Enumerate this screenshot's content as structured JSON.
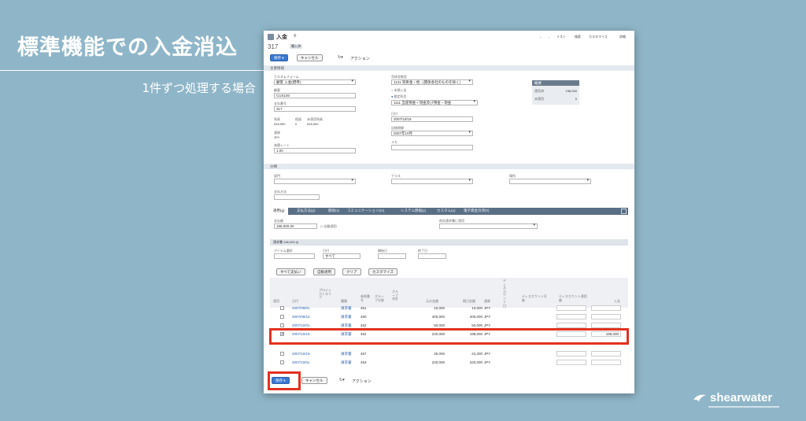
{
  "slide": {
    "headline": "標準機能での入金消込",
    "subline": "1件ずつ処理する場合",
    "brand": "shearwater"
  },
  "window": {
    "title": "入金",
    "record_number": "317",
    "record_status": "購入済",
    "nav": {
      "list": "リスト",
      "search": "検索",
      "customize": "カスタマイズ",
      "more": "詳細"
    }
  },
  "toolbar": {
    "save": "保存",
    "cancel": "キャンセル",
    "actions": "アクション"
  },
  "sections": {
    "main": "主要情報",
    "classification": "分類"
  },
  "form": {
    "custom_form_label": "カスタムフォーム",
    "custom_form_value": "顧客 入金(標準)",
    "customer_label": "顧客",
    "customer_value": "CUS100",
    "payment_no_label": "支払番号",
    "payment_no_value": "317",
    "balance_label": "残高",
    "balance_value": "516,900",
    "pending_label": "保留",
    "pending_value": "0",
    "unapplied_label": "未適用残高",
    "unapplied_value": "516,900",
    "currency_label": "通貨",
    "currency_value": "JPY",
    "rate_label": "為替レート",
    "rate_value": "1.00",
    "ar_account_label": "売掛金勘定",
    "ar_account_value": "1131 売掛金・他...(関係会社のものを除く)",
    "undeposited_label": "未預入金",
    "deposit_label": "勘定科目",
    "deposit_account_value": "1111 当座預金・現金及び預金・現金",
    "date_label": "日付",
    "date_value": "2007/10/19",
    "period_label": "記帳期間",
    "period_value": "2007年10月",
    "memo_label": "メモ",
    "dept_label": "部門",
    "class_label": "クラス",
    "location_label": "場所",
    "payment_method_label": "支払方法"
  },
  "summary": {
    "title": "概要",
    "applied_label": "適用済",
    "applied_value": "198,000",
    "unapplied_label": "未適用",
    "unapplied_value": "0"
  },
  "tabs": [
    "適用(g)",
    "支払方法(p)",
    "関係(s)",
    "コミュニケーション(m)",
    "システム情報(y)",
    "カスタム(u)",
    "電子資金決済(h)"
  ],
  "apply": {
    "payment_label": "支払額",
    "payment_value": "198,000.00",
    "auto_apply_label": "自動適用",
    "reconcile_label": "前払請求書に適用",
    "invoice_group": "請求書 198,000 (i)",
    "filter_item_label": "アイテム選択",
    "filter_date_label": "日付",
    "filter_date_value": "すべて",
    "filter_start_label": "開始日",
    "filter_end_label": "終了日",
    "btn_pay_all": "すべて支払い",
    "btn_auto": "自動適用",
    "btn_clear": "クリア",
    "btn_custom": "カスタマイズ"
  },
  "columns": [
    "適用",
    "日付",
    "プロジェクトタイプ",
    "種類",
    "参照番号",
    "グループ分割",
    "グループ合計",
    "元の金額",
    "期日金額",
    "通貨",
    "ディスカウント日",
    "ディスカウント可能",
    "ディスカウント適用額",
    "入金"
  ],
  "rows": [
    {
      "checked": false,
      "date": "2007/09/01",
      "type": "請求書",
      "ref": "451",
      "orig": "10,000",
      "due": "10,000",
      "cur": "JPY",
      "pay": ""
    },
    {
      "checked": false,
      "date": "2007/09/10",
      "type": "請求書",
      "ref": "450",
      "orig": "400,000",
      "due": "200,000",
      "cur": "JPY",
      "pay": ""
    },
    {
      "checked": false,
      "date": "2007/10/01",
      "type": "請求書",
      "ref": "462",
      "orig": "50,000",
      "due": "50,000",
      "cur": "JPY",
      "pay": ""
    },
    {
      "checked": true,
      "date": "2007/10/19",
      "type": "請求書",
      "ref": "452",
      "orig": "220,000",
      "due": "198,000",
      "cur": "JPY",
      "pay": "198,000"
    },
    {
      "checked": false,
      "date": "2007/10/19",
      "type": "請求書",
      "ref": "457",
      "orig": "25,000",
      "due": "24,200",
      "cur": "JPY",
      "pay": ""
    },
    {
      "checked": false,
      "date": "2007/10/01",
      "type": "請求書",
      "ref": "453",
      "orig": "220,000",
      "due": "220,000",
      "cur": "JPY",
      "pay": ""
    }
  ]
}
